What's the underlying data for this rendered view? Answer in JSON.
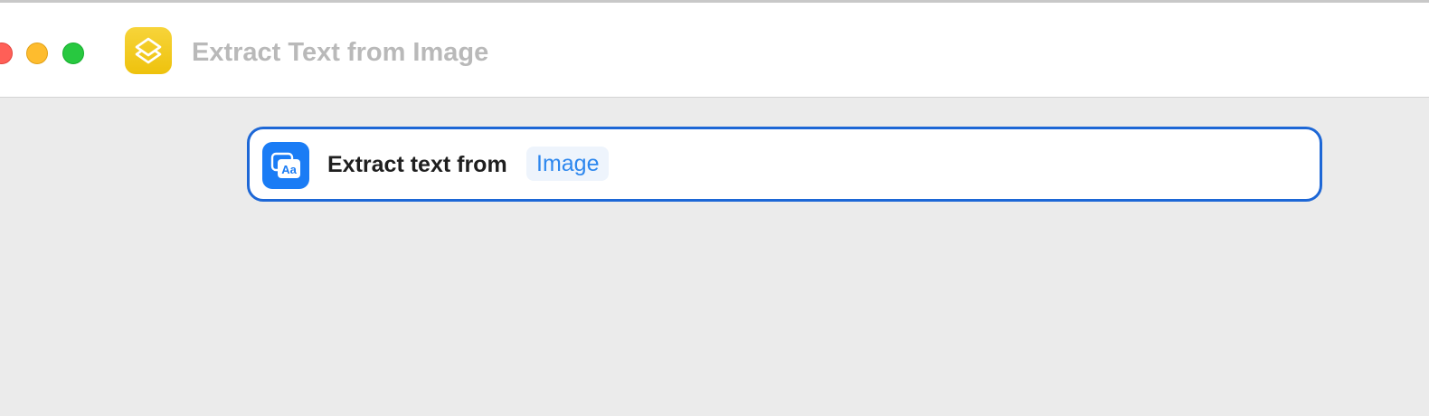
{
  "window": {
    "title": "Extract Text from Image",
    "app_icon": "shortcuts-icon",
    "controls": [
      "close",
      "minimize",
      "zoom"
    ]
  },
  "action": {
    "icon": "extract-text-icon",
    "icon_glyph": "Aa",
    "label": "Extract text from",
    "parameter": "Image"
  },
  "colors": {
    "accent": "#1d67d6",
    "parameter_text": "#2d87ee",
    "app_icon": "#f2c81c",
    "background": "#ebebeb"
  }
}
